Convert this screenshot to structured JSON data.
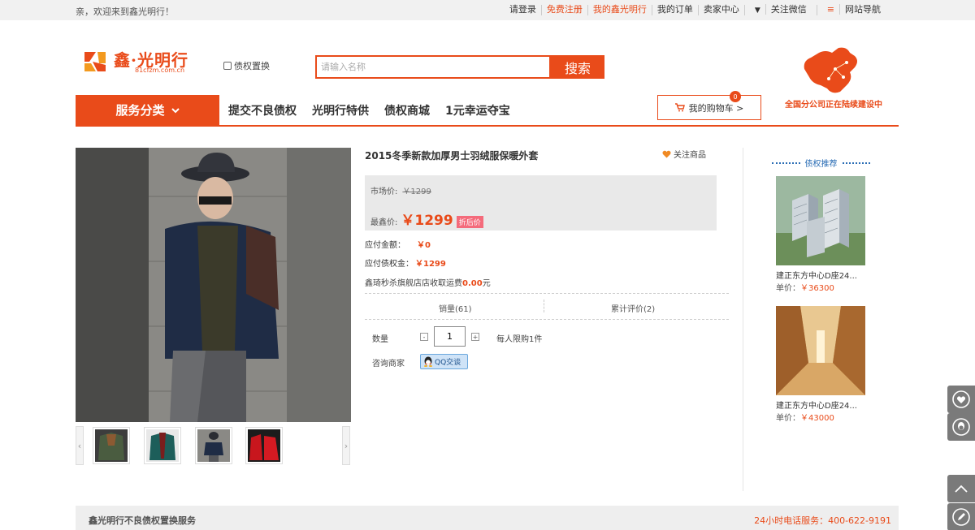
{
  "topbar": {
    "welcome": "亲，欢迎来到鑫光明行！",
    "links": [
      "请登录",
      "免费注册",
      "我的鑫光明行",
      "我的订单",
      "卖家中心",
      "关注微信",
      "网站导航"
    ]
  },
  "header": {
    "logo_name": "鑫·光明行",
    "logo_domain": "81cfzm.com.cn",
    "debt_swap": "债权置换",
    "search_placeholder": "请输入名称",
    "search_button": "搜索",
    "map_caption": "全国分公司正在陆续建设中"
  },
  "nav": {
    "category": "服务分类",
    "items": [
      "提交不良债权",
      "光明行特供",
      "债权商城",
      "1元幸运夺宝"
    ],
    "cart_label": "我的购物车 >",
    "cart_count": "0"
  },
  "product": {
    "title": "2015冬季新款加厚男士羽绒服保暖外套",
    "follow": "关注商品",
    "market_label": "市场价:",
    "market_price": "￥1299",
    "best_label": "最鑫价:",
    "best_price": "￥1299",
    "discount_tag": "折后价",
    "pay_label": "应付金额：",
    "pay_value": "￥0",
    "debt_label": "应付债权金：",
    "debt_value": "￥1299",
    "ship_prefix": "鑫琦秒杀旗舰店店收取运费",
    "ship_value": "0.00",
    "ship_suffix": "元",
    "sales": "销量(61)",
    "reviews": "累计评价(2)",
    "qty_label": "数量",
    "qty_value": "1",
    "limit": "每人限购1件",
    "consult_label": "咨询商家",
    "qq_label": "QQ交谈"
  },
  "recommend": {
    "title": "债权推荐",
    "items": [
      {
        "name": "建正东方中心D座24...",
        "price_label": "单价：",
        "price": "￥36300"
      },
      {
        "name": "建正东方中心D座24...",
        "price_label": "单价：",
        "price": "￥43000"
      }
    ]
  },
  "footer": {
    "left": "鑫光明行不良债权置换服务",
    "right": "24小时电话服务：400-622-9191"
  },
  "colors": {
    "accent": "#e94b1a",
    "link_blue": "#2a6db5"
  }
}
